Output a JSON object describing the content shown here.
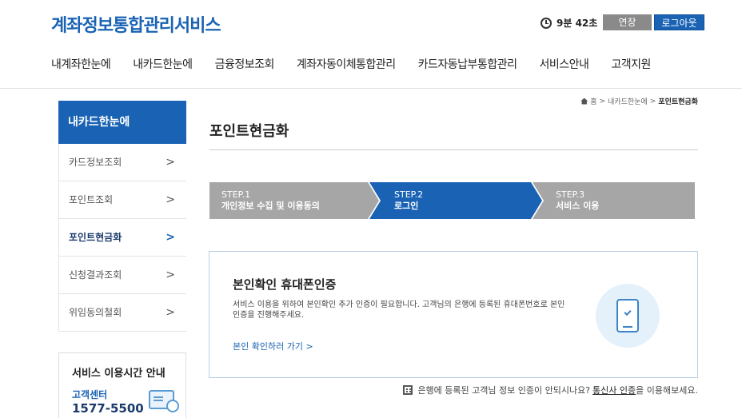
{
  "header": {
    "logo": "계좌정보통합관리서비스",
    "timer": "9분 42초",
    "extend_label": "연장",
    "logout_label": "로그아웃"
  },
  "gnb": [
    "내계좌한눈에",
    "내카드한눈에",
    "금융정보조회",
    "계좌자동이체통합관리",
    "카드자동납부통합관리",
    "서비스안내",
    "고객지원"
  ],
  "sidebar": {
    "title": "내카드한눈에",
    "items": [
      {
        "label": "카드정보조회"
      },
      {
        "label": "포인트조회"
      },
      {
        "label": "포인트현금화"
      },
      {
        "label": "신청결과조회"
      },
      {
        "label": "위임동의철회"
      }
    ],
    "arrow": ">",
    "service_box": {
      "title": "서비스 이용시간 안내",
      "label": "고객센터",
      "number": "1577-5500"
    }
  },
  "breadcrumb": {
    "home": "홈",
    "sep": ">",
    "parent": "내카드한눈에",
    "current": "포인트현금화"
  },
  "page_title": "포인트현금화",
  "steps": [
    {
      "num": "STEP.1",
      "text": "개인정보 수집 및 이용동의"
    },
    {
      "num": "STEP.2",
      "text": "로그인"
    },
    {
      "num": "STEP.3",
      "text": "서비스 이용"
    }
  ],
  "auth": {
    "title": "본인확인 휴대폰인증",
    "desc": "서비스 이용을 위하여 본인확인 추가 인증이 필요합니다. 고객님의 은행에 등록된 휴대폰번호로 본인인증을 진행해주세요.",
    "link": "본인 확인하러 가기 >"
  },
  "notice": {
    "prefix": "은행에 등록된 고객님 정보 인증이 안되시나요?",
    "link": "통신사 인증",
    "suffix": "을 이용해보세요."
  },
  "colors": {
    "brand": "#1a63b4",
    "step_inactive": "#a6a6a6"
  }
}
